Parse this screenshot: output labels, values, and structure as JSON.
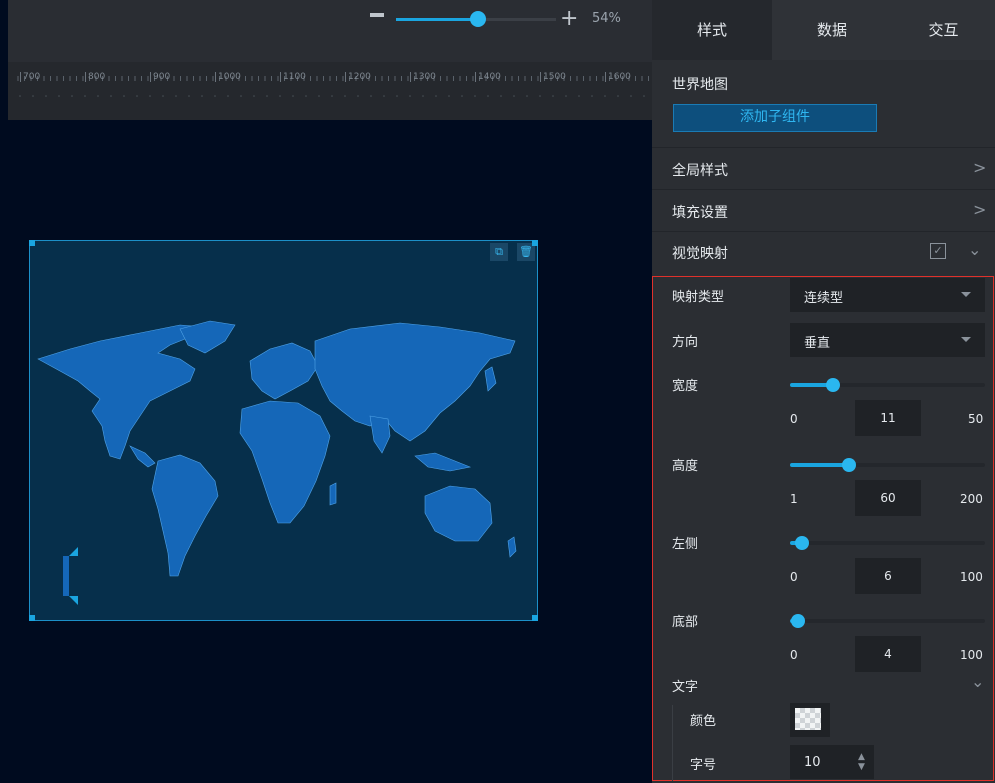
{
  "toolbar": {
    "zoom_value": "54%",
    "zoom_level": 0.54
  },
  "ruler": {
    "ticks": [
      "700",
      "800",
      "900",
      "1000",
      "1100",
      "1200",
      "1300",
      "1400",
      "1500",
      "1600"
    ]
  },
  "widget": {
    "copy_icon": "copy-icon",
    "delete_icon": "trash-icon"
  },
  "panel": {
    "tabs": [
      "样式",
      "数据",
      "交互"
    ],
    "component_title": "世界地图",
    "add_child_label": "添加子组件",
    "sections": {
      "global": "全局样式",
      "fill": "填充设置",
      "visual": "视觉映射"
    },
    "visual_mapping": {
      "type_label": "映射类型",
      "type_value": "连续型",
      "direction_label": "方向",
      "direction_value": "垂直",
      "width": {
        "label": "宽度",
        "min": "0",
        "value": "11",
        "max": "50",
        "fraction": 0.22
      },
      "height": {
        "label": "高度",
        "min": "1",
        "value": "60",
        "max": "200",
        "fraction": 0.3
      },
      "left": {
        "label": "左侧",
        "min": "0",
        "value": "6",
        "max": "100",
        "fraction": 0.06
      },
      "bottom": {
        "label": "底部",
        "min": "0",
        "value": "4",
        "max": "100",
        "fraction": 0.04
      }
    },
    "text_section": {
      "label": "文字",
      "color_label": "颜色",
      "size_label": "字号",
      "size_value": "10"
    }
  },
  "colors": {
    "accent": "#1aa5e0",
    "highlight_border": "#e0312b",
    "map_land": "#1567b8"
  }
}
